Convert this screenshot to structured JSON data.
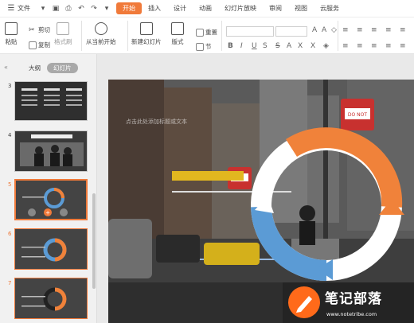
{
  "menubar": {
    "file_label": "文件",
    "tabs": [
      "开始",
      "插入",
      "设计",
      "动画",
      "幻灯片放映",
      "审阅",
      "视图",
      "云服务"
    ],
    "active_tab": "开始"
  },
  "ribbon": {
    "paste": "粘贴",
    "cut": "剪切",
    "copy": "复制",
    "format_painter": "格式刷",
    "play_from_current": "从当前开始",
    "new_slide": "新建幻灯片",
    "layout": "版式",
    "reset": "重置",
    "section": "节"
  },
  "panel": {
    "tabs": [
      "大纲",
      "幻灯片"
    ],
    "active_tab": "幻灯片",
    "slide_numbers": [
      "3",
      "4",
      "5",
      "6",
      "7"
    ],
    "selected_slide": "5"
  },
  "slide": {
    "placeholder_text": "点击此处添加标题或文本"
  },
  "watermark": {
    "title": "笔记部落",
    "url": "www.notetribe.com"
  },
  "colors": {
    "accent": "#F07A3A",
    "ring_orange": "#F0823A",
    "ring_blue": "#5B9BD5",
    "sign_red": "#C8312F"
  }
}
